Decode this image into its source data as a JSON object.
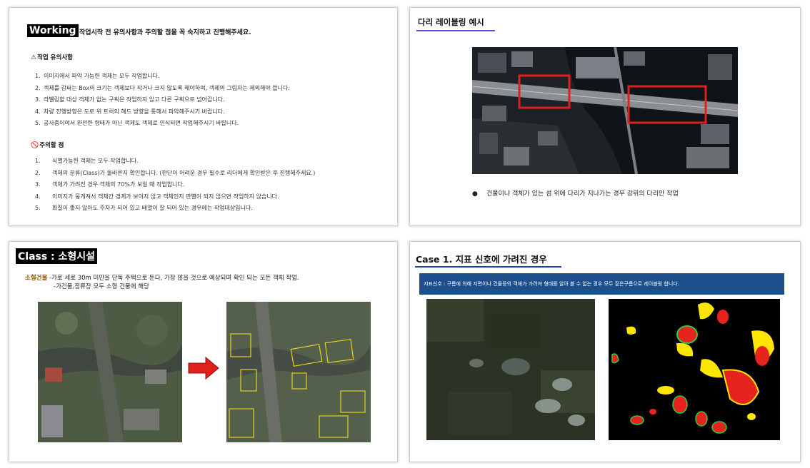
{
  "slide1": {
    "badge": "Working",
    "heading": "작업시작 전 유의사항과 주의할 점을 꼭 숙지하고 진행해주세요.",
    "section1_icon": "⚠",
    "section1_title": "작업 유의사항",
    "section1_items": [
      {
        "num": "1.",
        "text": "이미지에서 파악 가능한 객체는 모두 작업합니다."
      },
      {
        "num": "2.",
        "text": "객체를 감싸는 Box의 크기는 객체보다 작거나 크지 않도록 해야하며, 객체의 그림자는 제외해야 합니다."
      },
      {
        "num": "3.",
        "text": "라벨링할 대상 객체가 없는 구획은 작업하지 않고 다른 구획으로 넘어갑니다."
      },
      {
        "num": "4.",
        "text": "차량 진행방향은 도로 위 트럭의 헤드 방향을 통해서 파악해주시기 바랍니다."
      },
      {
        "num": "5.",
        "text": "공사중이여서 완전한 형태가 아닌 객체도 객체로 인식되면 작업해주시기 바랍니다."
      }
    ],
    "section2_icon": "🚫",
    "section2_title": "주의할 점",
    "section2_items": [
      {
        "num": "1.",
        "text": "식별가능한 객체는 모두 작업합니다."
      },
      {
        "num": "2.",
        "text": "객체의 분류(Class)가 올바른지 확인합니다. (판단이 어려운 경우 필수로 리더에게 확인받은 후 진행해주세요.)"
      },
      {
        "num": "3.",
        "text": "객체가 가려진 경우 객체의 70%가 보일 때 작업합니다."
      },
      {
        "num": "4.",
        "text": "이미지가 뭉개져서 객체간 경계가 보이지 않고 객체인지 판별이 되지 않으면 작업하지 않습니다."
      },
      {
        "num": "5.",
        "text": "화질이 좋지 않아도 주차가 되어 있고 배열이 잘 되어 있는 경우에는 작업대상입니다."
      }
    ]
  },
  "slide2": {
    "title": "다리 레이블링 예시",
    "bullet": "●",
    "caption": "건물이나 객체가 있는 섬 위에 다리가 지나가는 경우 강위의 다리만 작업",
    "box_color": "#e0201c"
  },
  "slide3": {
    "badge": "Class : 소형시설",
    "keyword": "소형건물",
    "line1_rest": " -가로 세로 30m 미만을 단독 주택으로 둔다, 가장 많을 것으로 예상되며 확인 되는 모든 객체 작업.",
    "line2": "-가건물,정류장 모두 소형 건물에 해당",
    "arrow_color": "#e0201c",
    "polygon_color": "#e6d21e"
  },
  "slide4": {
    "title": "Case 1. 지표 신호에 가려진 경우",
    "banner": "지표신호 : 구름에 의해 지면이나 건물등의 객체가 가려져 형태를 알아 볼 수 없는 경우 모두 짙은구름으로 레이블링 합니다.",
    "banner_color": "#1c4f8c",
    "mask_colors": [
      "#ffe600",
      "#e6231e",
      "#2ecc40"
    ]
  }
}
